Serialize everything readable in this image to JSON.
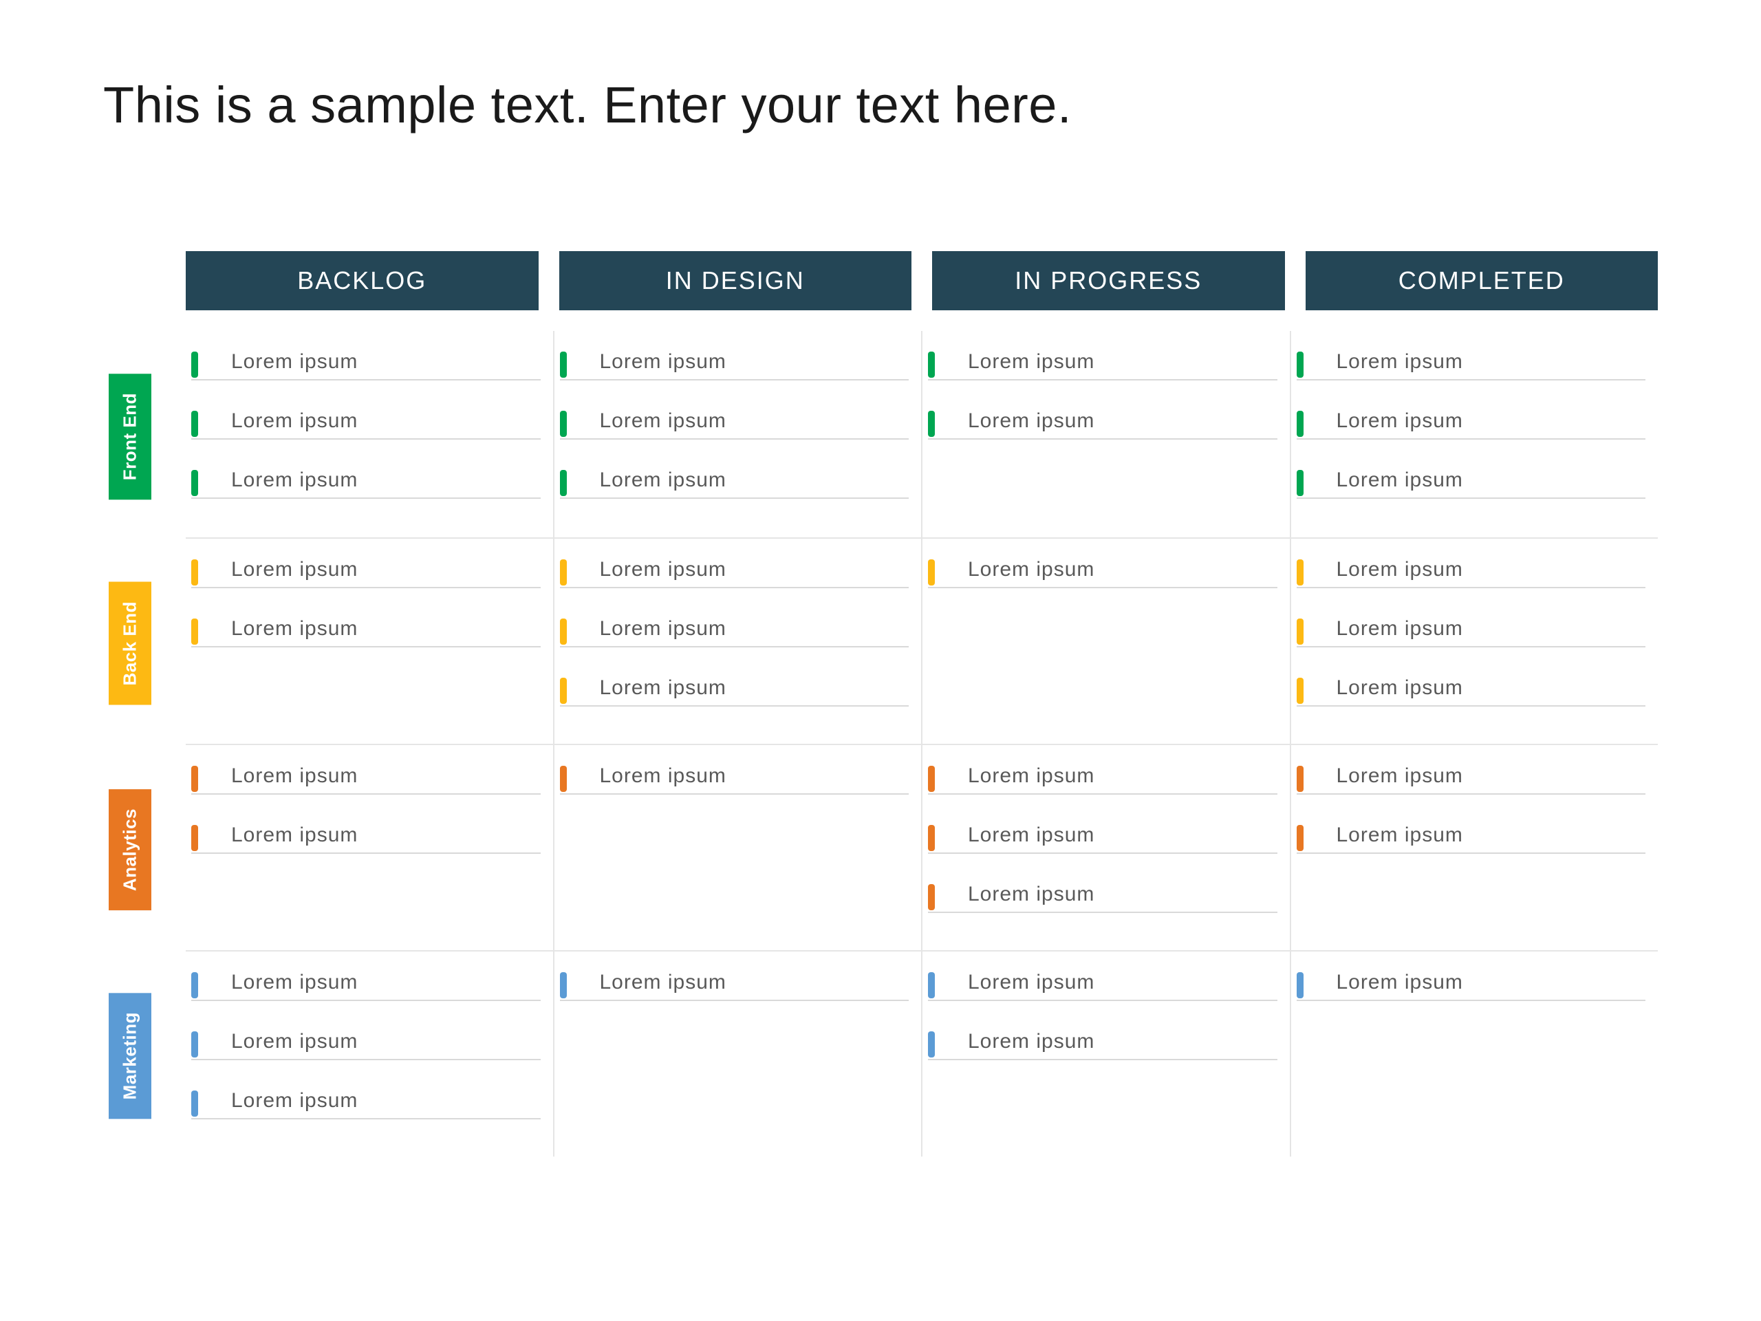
{
  "title": "This is a sample text. Enter your text here.",
  "columns": [
    "BACKLOG",
    "IN DESIGN",
    "IN PROGRESS",
    "COMPLETED"
  ],
  "rows": [
    {
      "label": "Front End",
      "color": "#00a651",
      "cells": [
        [
          "Lorem ipsum",
          "Lorem ipsum",
          "Lorem ipsum"
        ],
        [
          "Lorem ipsum",
          "Lorem ipsum",
          "Lorem ipsum"
        ],
        [
          "Lorem ipsum",
          "Lorem ipsum"
        ],
        [
          "Lorem ipsum",
          "Lorem ipsum",
          "Lorem ipsum"
        ]
      ]
    },
    {
      "label": "Back End",
      "color": "#fdb913",
      "cells": [
        [
          "Lorem ipsum",
          "Lorem ipsum"
        ],
        [
          "Lorem ipsum",
          "Lorem ipsum",
          "Lorem ipsum"
        ],
        [
          "Lorem ipsum"
        ],
        [
          "Lorem ipsum",
          "Lorem ipsum",
          "Lorem ipsum"
        ]
      ]
    },
    {
      "label": "Analytics",
      "color": "#e87722",
      "cells": [
        [
          "Lorem ipsum",
          "Lorem ipsum"
        ],
        [
          "Lorem ipsum"
        ],
        [
          "Lorem ipsum",
          "Lorem ipsum",
          "Lorem ipsum"
        ],
        [
          "Lorem ipsum",
          "Lorem ipsum"
        ]
      ]
    },
    {
      "label": "Marketing",
      "color": "#5b9bd5",
      "cells": [
        [
          "Lorem ipsum",
          "Lorem ipsum",
          "Lorem ipsum"
        ],
        [
          "Lorem ipsum"
        ],
        [
          "Lorem ipsum",
          "Lorem ipsum"
        ],
        [
          "Lorem ipsum"
        ]
      ]
    }
  ]
}
